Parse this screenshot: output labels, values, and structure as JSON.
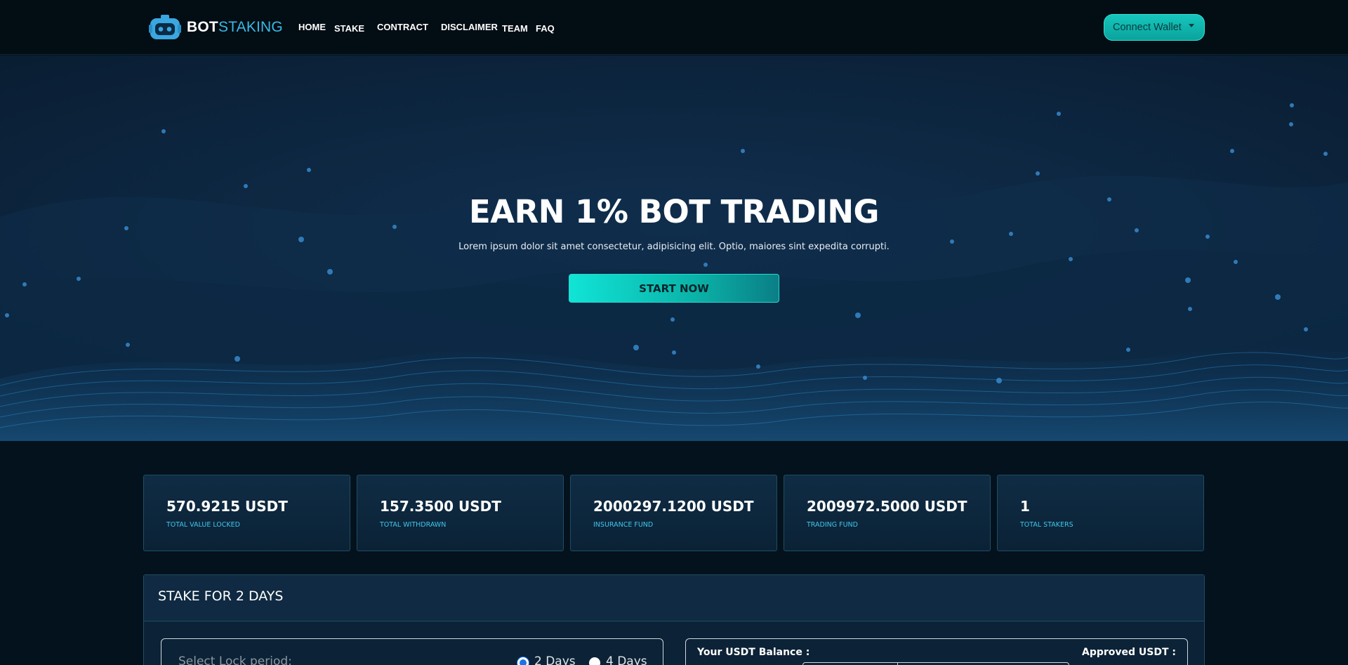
{
  "brand": {
    "name_bold": "BOT",
    "name_light": "STAKING"
  },
  "nav": {
    "items": [
      {
        "label": "HOME"
      },
      {
        "label": "STAKE"
      },
      {
        "label": "CONTRACT"
      },
      {
        "label": "DISCLAIMER"
      },
      {
        "label": "TEAM"
      },
      {
        "label": "FAQ"
      }
    ],
    "connect_label": "Connect Wallet"
  },
  "hero": {
    "title": "EARN 1% BOT TRADING",
    "subtitle": "Lorem ipsum dolor sit amet consectetur, adipisicing elit. Optio, maiores sint expedita corrupti.",
    "cta": "START NOW"
  },
  "stats": [
    {
      "value": "570.9215 USDT",
      "label": "TOTAL VALUE LOCKED"
    },
    {
      "value": "157.3500 USDT",
      "label": "TOTAL WITHDRAWN"
    },
    {
      "value": "2000297.1200 USDT",
      "label": "INSURANCE FUND"
    },
    {
      "value": "2009972.5000 USDT",
      "label": "TRADING FUND"
    },
    {
      "value": "1",
      "label": "TOTAL STAKERS"
    }
  ],
  "stake": {
    "title": "STAKE FOR 2 DAYS",
    "lock_label": "Select Lock period:",
    "options": [
      {
        "label": "2 Days",
        "selected": true
      },
      {
        "label": "4 Days",
        "selected": false
      }
    ],
    "balance_label": "Your USDT Balance :",
    "approved_label": "Approved USDT :"
  },
  "colors": {
    "accent": "#0bd6cb",
    "label": "#3fc7ee",
    "background": "#04121d"
  }
}
